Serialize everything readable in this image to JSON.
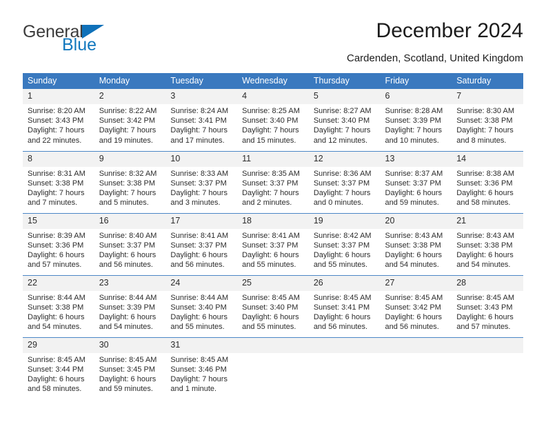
{
  "brand": {
    "name_part1": "General",
    "name_part2": "Blue",
    "triangle_color": "#0f71b9",
    "text_color": "#3c3c3c",
    "accent_color": "#1278be"
  },
  "header": {
    "title": "December 2024",
    "subtitle": "Cardenden, Scotland, United Kingdom"
  },
  "theme": {
    "header_bg": "#3a79bf",
    "header_text": "#ffffff",
    "daynum_bg": "#f2f2f2",
    "separator": "#4a86c6",
    "body_text": "#2b2b2b"
  },
  "weekday_headers": [
    "Sunday",
    "Monday",
    "Tuesday",
    "Wednesday",
    "Thursday",
    "Friday",
    "Saturday"
  ],
  "weeks": [
    [
      {
        "day": "1",
        "sunrise": "Sunrise: 8:20 AM",
        "sunset": "Sunset: 3:43 PM",
        "daylight_1": "Daylight: 7 hours",
        "daylight_2": "and 22 minutes."
      },
      {
        "day": "2",
        "sunrise": "Sunrise: 8:22 AM",
        "sunset": "Sunset: 3:42 PM",
        "daylight_1": "Daylight: 7 hours",
        "daylight_2": "and 19 minutes."
      },
      {
        "day": "3",
        "sunrise": "Sunrise: 8:24 AM",
        "sunset": "Sunset: 3:41 PM",
        "daylight_1": "Daylight: 7 hours",
        "daylight_2": "and 17 minutes."
      },
      {
        "day": "4",
        "sunrise": "Sunrise: 8:25 AM",
        "sunset": "Sunset: 3:40 PM",
        "daylight_1": "Daylight: 7 hours",
        "daylight_2": "and 15 minutes."
      },
      {
        "day": "5",
        "sunrise": "Sunrise: 8:27 AM",
        "sunset": "Sunset: 3:40 PM",
        "daylight_1": "Daylight: 7 hours",
        "daylight_2": "and 12 minutes."
      },
      {
        "day": "6",
        "sunrise": "Sunrise: 8:28 AM",
        "sunset": "Sunset: 3:39 PM",
        "daylight_1": "Daylight: 7 hours",
        "daylight_2": "and 10 minutes."
      },
      {
        "day": "7",
        "sunrise": "Sunrise: 8:30 AM",
        "sunset": "Sunset: 3:38 PM",
        "daylight_1": "Daylight: 7 hours",
        "daylight_2": "and 8 minutes."
      }
    ],
    [
      {
        "day": "8",
        "sunrise": "Sunrise: 8:31 AM",
        "sunset": "Sunset: 3:38 PM",
        "daylight_1": "Daylight: 7 hours",
        "daylight_2": "and 7 minutes."
      },
      {
        "day": "9",
        "sunrise": "Sunrise: 8:32 AM",
        "sunset": "Sunset: 3:38 PM",
        "daylight_1": "Daylight: 7 hours",
        "daylight_2": "and 5 minutes."
      },
      {
        "day": "10",
        "sunrise": "Sunrise: 8:33 AM",
        "sunset": "Sunset: 3:37 PM",
        "daylight_1": "Daylight: 7 hours",
        "daylight_2": "and 3 minutes."
      },
      {
        "day": "11",
        "sunrise": "Sunrise: 8:35 AM",
        "sunset": "Sunset: 3:37 PM",
        "daylight_1": "Daylight: 7 hours",
        "daylight_2": "and 2 minutes."
      },
      {
        "day": "12",
        "sunrise": "Sunrise: 8:36 AM",
        "sunset": "Sunset: 3:37 PM",
        "daylight_1": "Daylight: 7 hours",
        "daylight_2": "and 0 minutes."
      },
      {
        "day": "13",
        "sunrise": "Sunrise: 8:37 AM",
        "sunset": "Sunset: 3:37 PM",
        "daylight_1": "Daylight: 6 hours",
        "daylight_2": "and 59 minutes."
      },
      {
        "day": "14",
        "sunrise": "Sunrise: 8:38 AM",
        "sunset": "Sunset: 3:36 PM",
        "daylight_1": "Daylight: 6 hours",
        "daylight_2": "and 58 minutes."
      }
    ],
    [
      {
        "day": "15",
        "sunrise": "Sunrise: 8:39 AM",
        "sunset": "Sunset: 3:36 PM",
        "daylight_1": "Daylight: 6 hours",
        "daylight_2": "and 57 minutes."
      },
      {
        "day": "16",
        "sunrise": "Sunrise: 8:40 AM",
        "sunset": "Sunset: 3:37 PM",
        "daylight_1": "Daylight: 6 hours",
        "daylight_2": "and 56 minutes."
      },
      {
        "day": "17",
        "sunrise": "Sunrise: 8:41 AM",
        "sunset": "Sunset: 3:37 PM",
        "daylight_1": "Daylight: 6 hours",
        "daylight_2": "and 56 minutes."
      },
      {
        "day": "18",
        "sunrise": "Sunrise: 8:41 AM",
        "sunset": "Sunset: 3:37 PM",
        "daylight_1": "Daylight: 6 hours",
        "daylight_2": "and 55 minutes."
      },
      {
        "day": "19",
        "sunrise": "Sunrise: 8:42 AM",
        "sunset": "Sunset: 3:37 PM",
        "daylight_1": "Daylight: 6 hours",
        "daylight_2": "and 55 minutes."
      },
      {
        "day": "20",
        "sunrise": "Sunrise: 8:43 AM",
        "sunset": "Sunset: 3:38 PM",
        "daylight_1": "Daylight: 6 hours",
        "daylight_2": "and 54 minutes."
      },
      {
        "day": "21",
        "sunrise": "Sunrise: 8:43 AM",
        "sunset": "Sunset: 3:38 PM",
        "daylight_1": "Daylight: 6 hours",
        "daylight_2": "and 54 minutes."
      }
    ],
    [
      {
        "day": "22",
        "sunrise": "Sunrise: 8:44 AM",
        "sunset": "Sunset: 3:38 PM",
        "daylight_1": "Daylight: 6 hours",
        "daylight_2": "and 54 minutes."
      },
      {
        "day": "23",
        "sunrise": "Sunrise: 8:44 AM",
        "sunset": "Sunset: 3:39 PM",
        "daylight_1": "Daylight: 6 hours",
        "daylight_2": "and 54 minutes."
      },
      {
        "day": "24",
        "sunrise": "Sunrise: 8:44 AM",
        "sunset": "Sunset: 3:40 PM",
        "daylight_1": "Daylight: 6 hours",
        "daylight_2": "and 55 minutes."
      },
      {
        "day": "25",
        "sunrise": "Sunrise: 8:45 AM",
        "sunset": "Sunset: 3:40 PM",
        "daylight_1": "Daylight: 6 hours",
        "daylight_2": "and 55 minutes."
      },
      {
        "day": "26",
        "sunrise": "Sunrise: 8:45 AM",
        "sunset": "Sunset: 3:41 PM",
        "daylight_1": "Daylight: 6 hours",
        "daylight_2": "and 56 minutes."
      },
      {
        "day": "27",
        "sunrise": "Sunrise: 8:45 AM",
        "sunset": "Sunset: 3:42 PM",
        "daylight_1": "Daylight: 6 hours",
        "daylight_2": "and 56 minutes."
      },
      {
        "day": "28",
        "sunrise": "Sunrise: 8:45 AM",
        "sunset": "Sunset: 3:43 PM",
        "daylight_1": "Daylight: 6 hours",
        "daylight_2": "and 57 minutes."
      }
    ],
    [
      {
        "day": "29",
        "sunrise": "Sunrise: 8:45 AM",
        "sunset": "Sunset: 3:44 PM",
        "daylight_1": "Daylight: 6 hours",
        "daylight_2": "and 58 minutes."
      },
      {
        "day": "30",
        "sunrise": "Sunrise: 8:45 AM",
        "sunset": "Sunset: 3:45 PM",
        "daylight_1": "Daylight: 6 hours",
        "daylight_2": "and 59 minutes."
      },
      {
        "day": "31",
        "sunrise": "Sunrise: 8:45 AM",
        "sunset": "Sunset: 3:46 PM",
        "daylight_1": "Daylight: 7 hours",
        "daylight_2": "and 1 minute."
      },
      {
        "day": "",
        "sunrise": "",
        "sunset": "",
        "daylight_1": "",
        "daylight_2": ""
      },
      {
        "day": "",
        "sunrise": "",
        "sunset": "",
        "daylight_1": "",
        "daylight_2": ""
      },
      {
        "day": "",
        "sunrise": "",
        "sunset": "",
        "daylight_1": "",
        "daylight_2": ""
      },
      {
        "day": "",
        "sunrise": "",
        "sunset": "",
        "daylight_1": "",
        "daylight_2": ""
      }
    ]
  ]
}
